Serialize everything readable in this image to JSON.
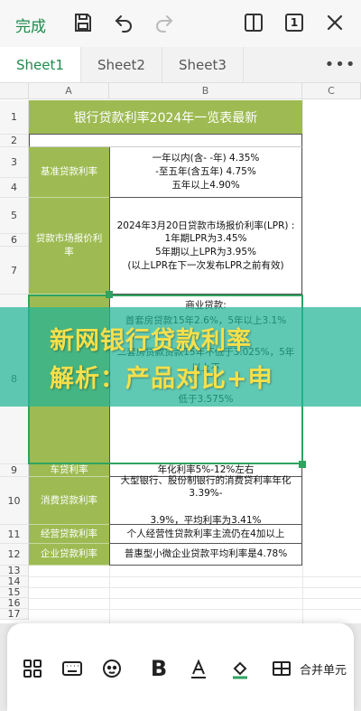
{
  "toolbar": {
    "done_label": "完成",
    "page_count": "1"
  },
  "tabs": [
    {
      "label": "Sheet1",
      "active": true
    },
    {
      "label": "Sheet2",
      "active": false
    },
    {
      "label": "Sheet3",
      "active": false
    }
  ],
  "more_label": "•••",
  "columns": [
    "A",
    "B",
    "C"
  ],
  "rows": [
    "1",
    "2",
    "3",
    "4",
    "5",
    "6",
    "7",
    "8",
    "9",
    "10",
    "11",
    "12",
    "13",
    "14",
    "15",
    "16",
    "17",
    "18",
    "19",
    "20",
    "21",
    "22"
  ],
  "table": {
    "title": "银行贷款利率2024年一览表最新",
    "items": [
      {
        "category": "基准贷款利率",
        "detail": "一年以内(含- -年) 4.35%\n-至五年(含五年) 4.75%\n五年以上4.90%"
      },
      {
        "category": "贷款市场报价利率",
        "detail": "2024年3月20日贷款市场报价利率(LPR) :\n1年期LPR为3.45%\n5年期以上LPR为3.95%\n(以上LPR在下一次发布LPR之前有效)"
      },
      {
        "category": "",
        "detail": "商业贷款:\n首套房贷款15年2.6%，5年以上3.1%\n\n二套房贷款贷款15年不低于3.025%，5年以上不\n\n低于3.575%"
      },
      {
        "category": "车贷利率",
        "detail": "年化利率5%-12%左右"
      },
      {
        "category": "消费贷款利率",
        "detail": "大型银行、股份制银行的消费贷利率年化3.39%-\n\n3.9%，平均利率为3.41%"
      },
      {
        "category": "经营贷款利率",
        "detail": "个人经营性贷款利率主流仍在4加以上"
      },
      {
        "category": "企业贷款利率",
        "detail": "普惠型小微企业贷款平均利率是4.78%"
      }
    ]
  },
  "watermark": {
    "line1": "新网银行贷款利率",
    "line2": "解析：产品对比+申"
  },
  "bottom_toolbar": {
    "merge_label": "合并单元"
  },
  "colors": {
    "accent": "#1f8b4c",
    "header_green": "#9dbb52",
    "selection": "#2fa35f",
    "watermark_text": "#f6e04a"
  }
}
